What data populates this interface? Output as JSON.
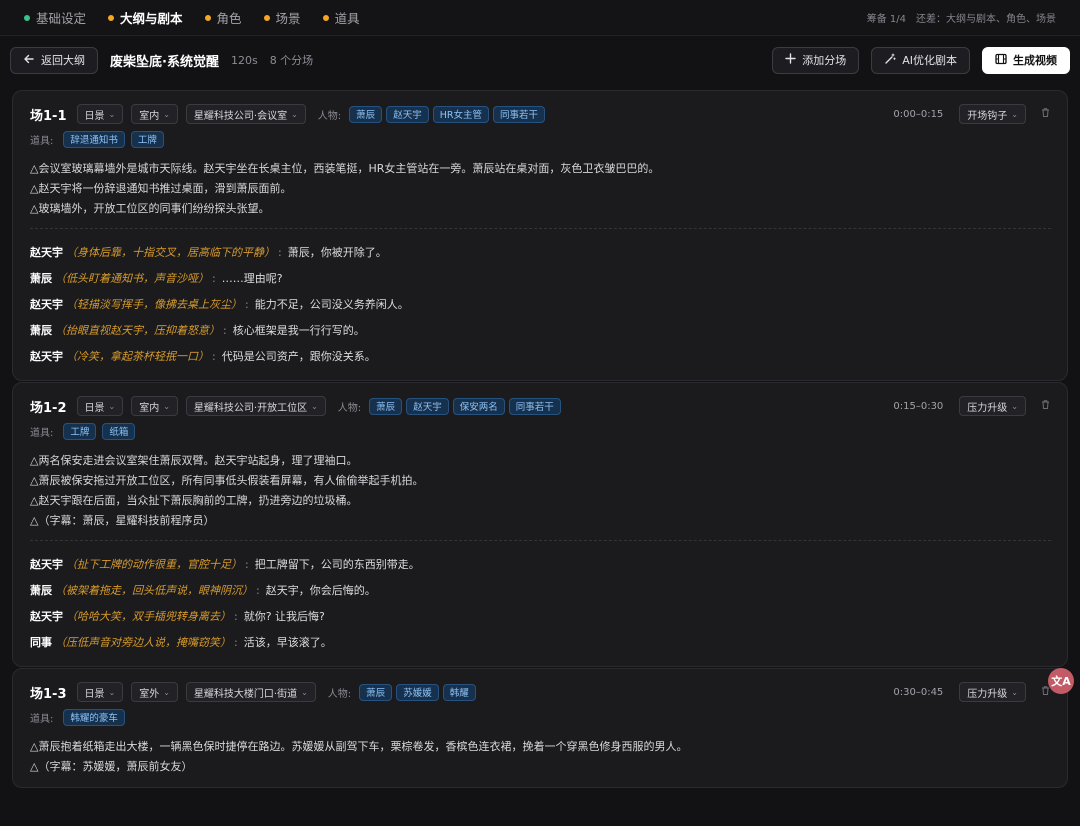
{
  "steps": [
    {
      "label": "基础设定",
      "color": "#39c28a",
      "active": false
    },
    {
      "label": "大纲与剧本",
      "color": "#f5a623",
      "active": true
    },
    {
      "label": "角色",
      "color": "#f5a623",
      "active": false
    },
    {
      "label": "场景",
      "color": "#f5a623",
      "active": false
    },
    {
      "label": "道具",
      "color": "#f5a623",
      "active": false
    }
  ],
  "status": "筹备 1/4　还差：大纲与剧本、角色、场景",
  "header": {
    "back_label": "返回大纲",
    "title": "废柴坠底·系统觉醒",
    "duration": "120s",
    "scene_count": "8 个分场",
    "add_scene": "添加分场",
    "ai_optimize": "AI优化剧本",
    "generate": "生成视频"
  },
  "scenes": [
    {
      "num": "场1-1",
      "daynight": "日景",
      "inout": "室内",
      "location": "星耀科技公司·会议室",
      "people_label": "人物:",
      "people": [
        "萧辰",
        "赵天宇",
        "HR女主管",
        "同事若干"
      ],
      "time": "0:00–0:15",
      "beat": "开场钩子",
      "props_label": "道具:",
      "props": [
        "辞退通知书",
        "工牌"
      ],
      "actions": [
        "△会议室玻璃幕墙外是城市天际线。赵天宇坐在长桌主位，西装笔挺，HR女主管站在一旁。萧辰站在桌对面，灰色卫衣皱巴巴的。",
        "△赵天宇将一份辞退通知书推过桌面，滑到萧辰面前。",
        "△玻璃墙外，开放工位区的同事们纷纷探头张望。"
      ],
      "dialogues": [
        {
          "speaker": "赵天宇",
          "paren": "（身体后靠，十指交叉，居高临下的平静）",
          "line": "萧辰，你被开除了。"
        },
        {
          "speaker": "萧辰",
          "paren": "（低头盯着通知书，声音沙哑）",
          "line": "……理由呢?"
        },
        {
          "speaker": "赵天宇",
          "paren": "（轻描淡写挥手，像拂去桌上灰尘）",
          "line": "能力不足，公司没义务养闲人。"
        },
        {
          "speaker": "萧辰",
          "paren": "（抬眼直视赵天宇，压抑着怒意）",
          "line": "核心框架是我一行行写的。"
        },
        {
          "speaker": "赵天宇",
          "paren": "（冷笑，拿起茶杯轻抿一口）",
          "line": "代码是公司资产，跟你没关系。"
        }
      ]
    },
    {
      "num": "场1-2",
      "daynight": "日景",
      "inout": "室内",
      "location": "星耀科技公司·开放工位区",
      "people_label": "人物:",
      "people": [
        "萧辰",
        "赵天宇",
        "保安两名",
        "同事若干"
      ],
      "time": "0:15–0:30",
      "beat": "压力升级",
      "props_label": "道具:",
      "props": [
        "工牌",
        "纸箱"
      ],
      "actions": [
        "△两名保安走进会议室架住萧辰双臂。赵天宇站起身，理了理袖口。",
        "△萧辰被保安拖过开放工位区，所有同事低头假装看屏幕，有人偷偷举起手机拍。",
        "△赵天宇跟在后面，当众扯下萧辰胸前的工牌，扔进旁边的垃圾桶。",
        "△（字幕：萧辰，星耀科技前程序员）"
      ],
      "dialogues": [
        {
          "speaker": "赵天宇",
          "paren": "（扯下工牌的动作很重，官腔十足）",
          "line": "把工牌留下，公司的东西别带走。"
        },
        {
          "speaker": "萧辰",
          "paren": "（被架着拖走，回头低声说，眼神阴沉）",
          "line": "赵天宇，你会后悔的。"
        },
        {
          "speaker": "赵天宇",
          "paren": "（哈哈大笑，双手插兜转身离去）",
          "line": "就你? 让我后悔?"
        },
        {
          "speaker": "同事",
          "paren": "（压低声音对旁边人说，掩嘴窃笑）",
          "line": "活该，早该滚了。"
        }
      ]
    },
    {
      "num": "场1-3",
      "daynight": "日景",
      "inout": "室外",
      "location": "星耀科技大楼门口·街道",
      "people_label": "人物:",
      "people": [
        "萧辰",
        "苏媛媛",
        "韩耀"
      ],
      "time": "0:30–0:45",
      "beat": "压力升级",
      "props_label": "道具:",
      "props": [
        "韩耀的豪车"
      ],
      "actions": [
        "△萧辰抱着纸箱走出大楼，一辆黑色保时捷停在路边。苏媛媛从副驾下车，栗棕卷发，香槟色连衣裙，挽着一个穿黑色修身西服的男人。",
        "△（字幕：苏媛媛，萧辰前女友）"
      ],
      "dialogues": []
    }
  ],
  "fab_icon": "translate-icon",
  "fab_text": "文A"
}
